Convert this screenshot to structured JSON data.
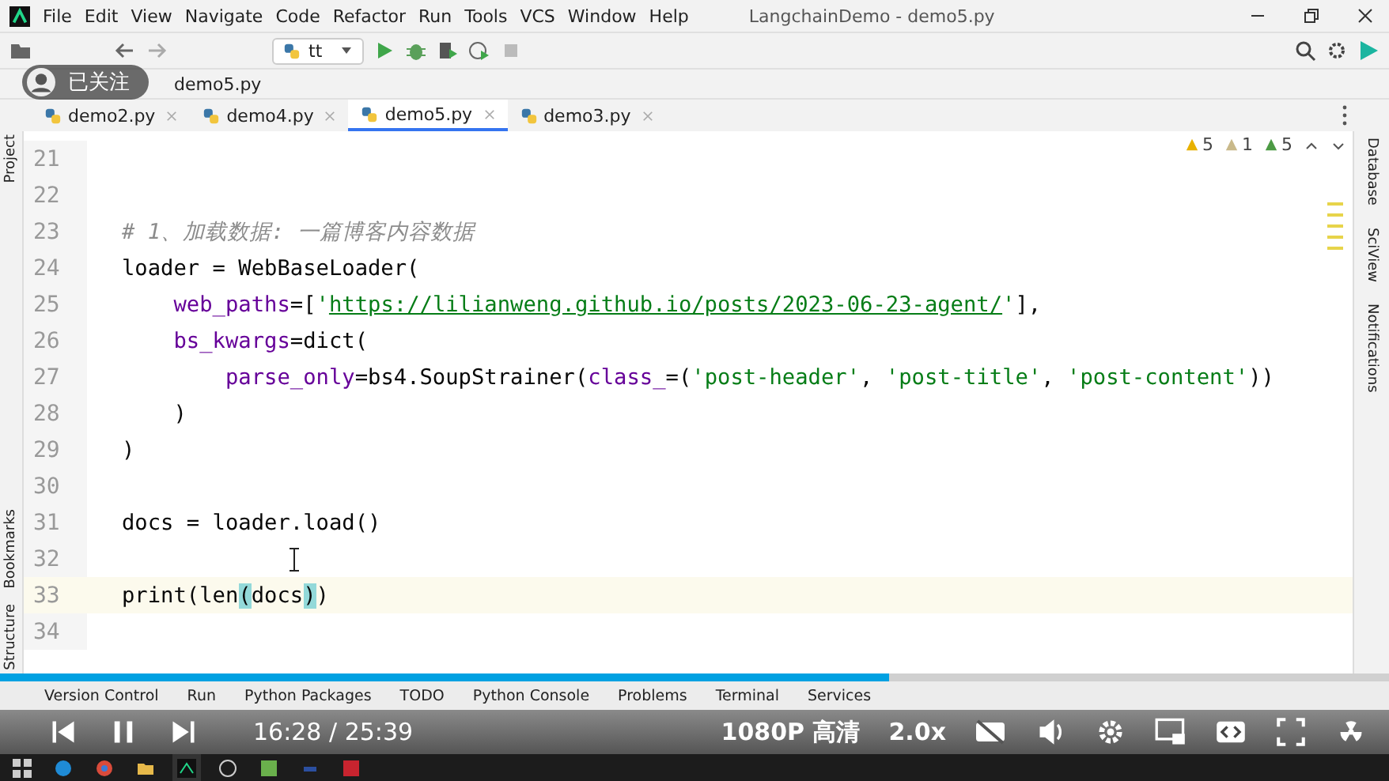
{
  "menu": [
    "File",
    "Edit",
    "View",
    "Navigate",
    "Code",
    "Refactor",
    "Run",
    "Tools",
    "VCS",
    "Window",
    "Help"
  ],
  "window": {
    "title": "LangchainDemo - demo5.py"
  },
  "toolbar": {
    "run_config": "tt"
  },
  "follow_badge": {
    "label": "已关注"
  },
  "breadcrumb": [
    "demo5.py"
  ],
  "tabs": [
    {
      "label": "demo2.py",
      "selected": false
    },
    {
      "label": "demo4.py",
      "selected": false
    },
    {
      "label": "demo5.py",
      "selected": true
    },
    {
      "label": "demo3.py",
      "selected": false
    }
  ],
  "left_sidebar": {
    "top": [
      "Project"
    ],
    "bottom": [
      "Bookmarks",
      "Structure"
    ]
  },
  "right_sidebar": [
    "Database",
    "SciView",
    "Notifications"
  ],
  "inspections": [
    {
      "kind": "warning",
      "count": "5"
    },
    {
      "kind": "weak",
      "count": "1"
    },
    {
      "kind": "typo",
      "count": "5"
    }
  ],
  "code": [
    {
      "number": "21",
      "current": false
    },
    {
      "number": "22",
      "current": false
    },
    {
      "number": "23",
      "current": false,
      "tokens": [
        {
          "kind": "comment",
          "text": "# 1、加载数据: 一篇博客内容数据"
        }
      ]
    },
    {
      "number": "24",
      "current": false,
      "tokens": [
        {
          "kind": "plain",
          "text": "loader = WebBaseLoader("
        }
      ]
    },
    {
      "number": "25",
      "current": false,
      "tokens": [
        {
          "kind": "param",
          "text": "    web_paths"
        },
        {
          "kind": "plain",
          "text": "=["
        },
        {
          "kind": "string",
          "text": "'"
        },
        {
          "kind": "link",
          "text": "https://lilianweng.github.io/posts/2023-06-23-agent/"
        },
        {
          "kind": "string",
          "text": "'"
        },
        {
          "kind": "plain",
          "text": "],"
        }
      ]
    },
    {
      "number": "26",
      "current": false,
      "tokens": [
        {
          "kind": "param",
          "text": "    bs_kwargs"
        },
        {
          "kind": "plain",
          "text": "=dict("
        }
      ]
    },
    {
      "number": "27",
      "current": false,
      "tokens": [
        {
          "kind": "param",
          "text": "        parse_only"
        },
        {
          "kind": "plain",
          "text": "=bs4.SoupStrainer("
        },
        {
          "kind": "param",
          "text": "class_"
        },
        {
          "kind": "plain",
          "text": "=("
        },
        {
          "kind": "string",
          "text": "'post-header'"
        },
        {
          "kind": "plain",
          "text": ", "
        },
        {
          "kind": "string",
          "text": "'post-title'"
        },
        {
          "kind": "plain",
          "text": ", "
        },
        {
          "kind": "string",
          "text": "'post-content'"
        },
        {
          "kind": "plain",
          "text": "))"
        }
      ]
    },
    {
      "number": "28",
      "current": false,
      "tokens": [
        {
          "kind": "plain",
          "text": "    )"
        }
      ]
    },
    {
      "number": "29",
      "current": false,
      "tokens": [
        {
          "kind": "plain",
          "text": ")"
        }
      ]
    },
    {
      "number": "30",
      "current": false
    },
    {
      "number": "31",
      "current": false,
      "tokens": [
        {
          "kind": "plain",
          "text": "docs = loader.load()"
        }
      ]
    },
    {
      "number": "32",
      "current": false
    },
    {
      "number": "33",
      "current": true,
      "tokens": [
        {
          "kind": "plain",
          "text": "print(len"
        },
        {
          "kind": "match",
          "text": "("
        },
        {
          "kind": "plain",
          "text": "docs"
        },
        {
          "kind": "match",
          "text": ")"
        },
        {
          "kind": "plain",
          "text": ")"
        }
      ]
    },
    {
      "number": "34",
      "current": false
    }
  ],
  "tool_windows": [
    "Version Control",
    "Run",
    "Python Packages",
    "TODO",
    "Python Console",
    "Problems",
    "Terminal",
    "Services"
  ],
  "player": {
    "level": 0.64,
    "time": "16:28 / 25:39",
    "quality": "1080P 高清",
    "speed": "2.0x"
  }
}
